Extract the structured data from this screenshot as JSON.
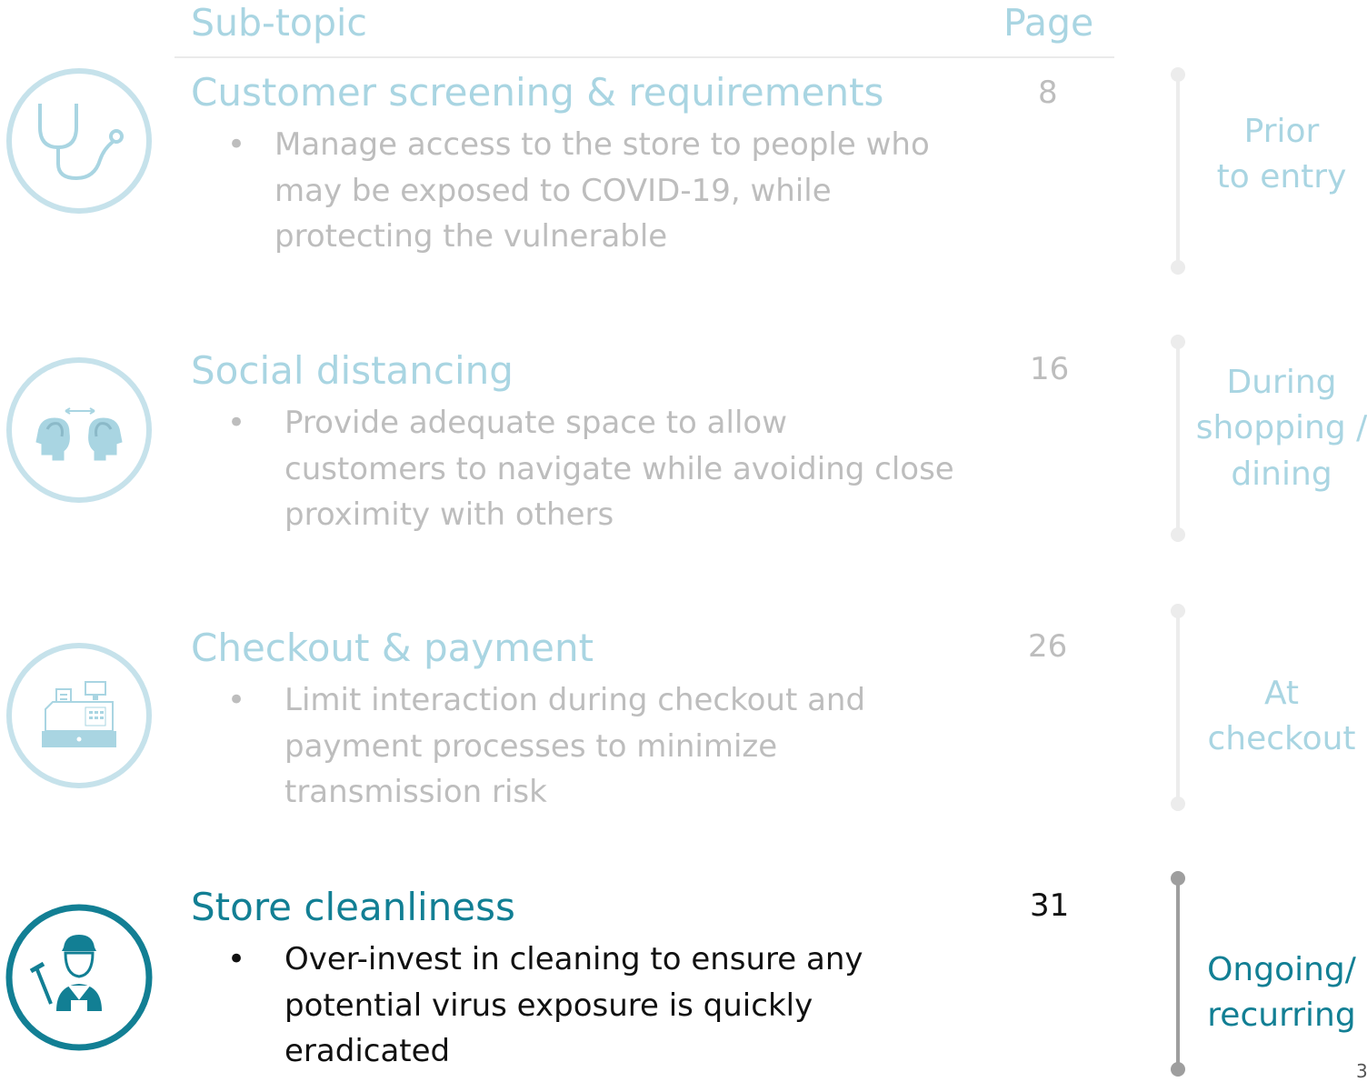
{
  "header": {
    "subtopic": "Sub-topic",
    "page": "Page"
  },
  "rows": [
    {
      "title": "Customer screening & requirements",
      "bullet": "Manage access to the store to people who may be exposed to COVID-19, while protecting the vulnerable",
      "page": "8",
      "phase": "Prior\nto entry",
      "icon": "stethoscope-icon"
    },
    {
      "title": "Social distancing",
      "bullet": "Provide adequate space to allow customers to navigate while avoiding close proximity with others",
      "page": "16",
      "phase": "During\nshopping /\ndining",
      "icon": "two-heads-distance-icon"
    },
    {
      "title": "Checkout & payment",
      "bullet": "Limit interaction during checkout and payment processes to minimize transmission risk",
      "page": "26",
      "phase": "At\ncheckout",
      "icon": "cash-register-icon"
    },
    {
      "title": "Store cleanliness",
      "bullet": "Over-invest in cleaning to ensure any potential virus exposure is quickly eradicated",
      "page": "31",
      "phase": "Ongoing/\nrecurring",
      "icon": "cleaner-worker-icon"
    }
  ],
  "bullet_symbol": "•",
  "slide_number": "3",
  "colors": {
    "accent": "#127f94",
    "accent_light": "#a9d5e2",
    "muted_text": "#bdbdbd",
    "active_text": "#111111"
  }
}
